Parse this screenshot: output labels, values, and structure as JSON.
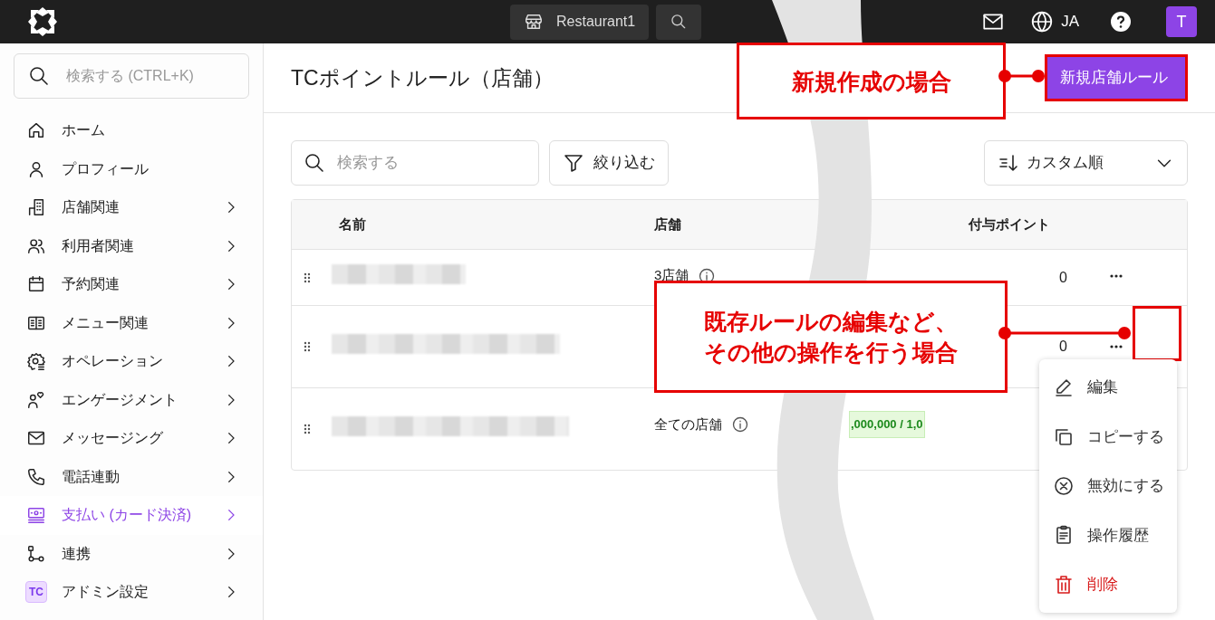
{
  "top_bar": {
    "store": "Restaurant1",
    "language": "JA",
    "avatar": "T"
  },
  "sidebar": {
    "search_placeholder": "検索する (CTRL+K)",
    "items": [
      {
        "label": "ホーム",
        "expandable": false,
        "selected": false
      },
      {
        "label": "プロフィール",
        "expandable": false,
        "selected": false
      },
      {
        "label": "店舗関連",
        "expandable": true,
        "selected": false
      },
      {
        "label": "利用者関連",
        "expandable": true,
        "selected": false
      },
      {
        "label": "予約関連",
        "expandable": true,
        "selected": false
      },
      {
        "label": "メニュー関連",
        "expandable": true,
        "selected": false
      },
      {
        "label": "オペレーション",
        "expandable": true,
        "selected": false
      },
      {
        "label": "エンゲージメント",
        "expandable": true,
        "selected": false
      },
      {
        "label": "メッセージング",
        "expandable": true,
        "selected": false
      },
      {
        "label": "電話連動",
        "expandable": true,
        "selected": false
      },
      {
        "label": "支払い (カード決済)",
        "expandable": true,
        "selected": true
      },
      {
        "label": "連携",
        "expandable": true,
        "selected": false
      },
      {
        "label": "アドミン設定",
        "expandable": true,
        "selected": false,
        "badge": "TC"
      }
    ]
  },
  "page": {
    "title": "TCポイントルール（店舗）",
    "new_button": "新規店舗ルール"
  },
  "toolbar": {
    "search_placeholder": "検索する",
    "filter": "絞り込む",
    "sort": "カスタム順"
  },
  "table": {
    "columns": [
      "名前",
      "店舗",
      "付与ポイント"
    ],
    "rows": [
      {
        "store": "3店舗",
        "points": "0"
      },
      {
        "points": "0"
      },
      {
        "store": "全ての店舗",
        "budget": ",000,000 / 1,0"
      }
    ]
  },
  "action_menu": [
    {
      "kind": "edit",
      "label": "編集"
    },
    {
      "kind": "copy",
      "label": "コピーする"
    },
    {
      "kind": "disable",
      "label": "無効にする"
    },
    {
      "kind": "history",
      "label": "操作履歴"
    },
    {
      "kind": "delete",
      "label": "削除"
    }
  ],
  "callouts": [
    {
      "lines": [
        "新規作成の場合"
      ]
    },
    {
      "lines": [
        "既存ルールの編集など、",
        "その他の操作を行う場合"
      ]
    }
  ]
}
